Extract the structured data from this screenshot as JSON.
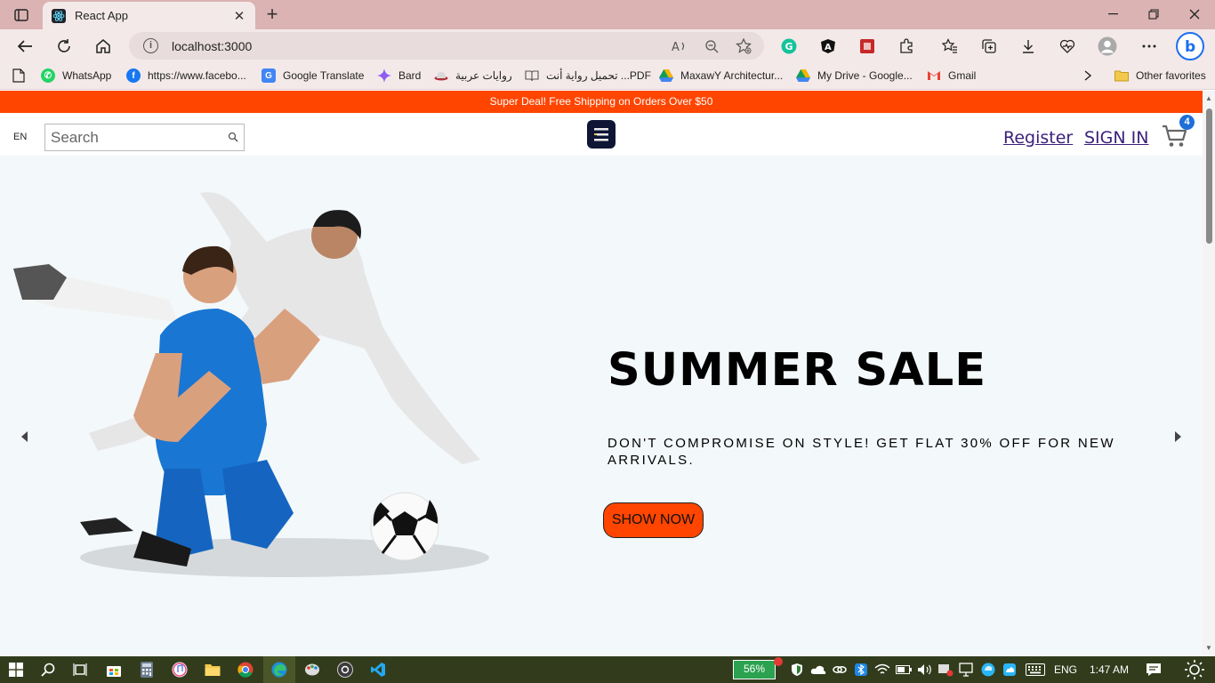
{
  "browser": {
    "tab_title": "React App",
    "url": "localhost:3000",
    "favorites": [
      {
        "label": "WhatsApp",
        "icon": "whatsapp-icon",
        "color": "#25d366"
      },
      {
        "label": "https://www.facebo...",
        "icon": "facebook-icon",
        "color": "#1877f2"
      },
      {
        "label": "Google Translate",
        "icon": "google-translate-icon",
        "color": "#4285f4"
      },
      {
        "label": "Bard",
        "icon": "bard-icon",
        "color": "#8e5cf0"
      },
      {
        "label": "روايات عربية",
        "icon": "hat-icon",
        "color": "#b0323a"
      },
      {
        "label": "تحميل رواية أنت ...PDF",
        "icon": "book-icon",
        "color": "#777777"
      },
      {
        "label": "MaxawY Architectur...",
        "icon": "google-drive-icon",
        "color": "#f4b400"
      },
      {
        "label": "My Drive - Google...",
        "icon": "google-drive-icon",
        "color": "#0f9d58"
      },
      {
        "label": "Gmail",
        "icon": "gmail-icon",
        "color": "#ea4335"
      }
    ],
    "other_favorites": "Other favorites"
  },
  "site": {
    "promo": "Super Deal! Free Shipping on Orders Over $50",
    "lang": "EN",
    "search_placeholder": "Search",
    "register": "Register",
    "signin": "SIGN IN",
    "cart_count": "4",
    "accent": "#ff4500"
  },
  "hero": {
    "title": "SUMMER SALE",
    "subtitle": "DON'T COMPROMISE ON STYLE! GET FLAT 30% OFF FOR NEW ARRIVALS.",
    "button": "SHOW NOW"
  },
  "taskbar": {
    "battery": "56%",
    "lang": "ENG",
    "time": "1:47 AM"
  }
}
